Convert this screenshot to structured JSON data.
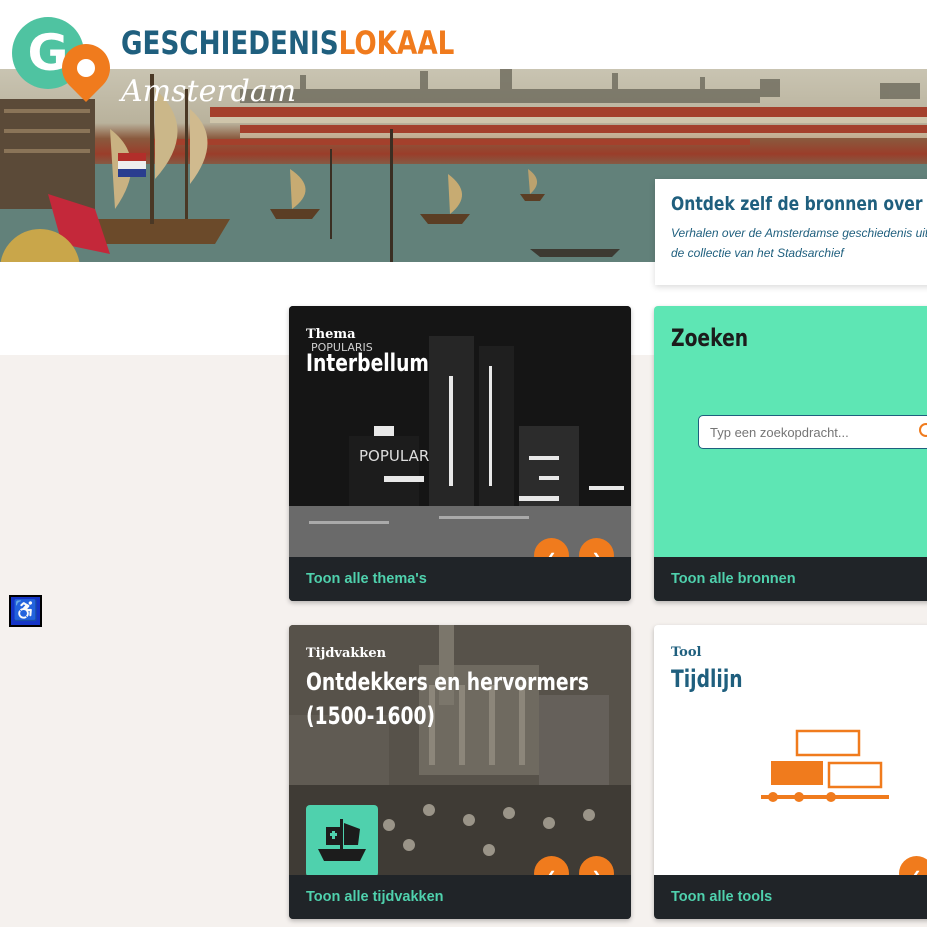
{
  "header": {
    "logo_letter": "G",
    "brand_part1": "GESCHIEDENIS",
    "brand_part2": "LOKAAL",
    "city": "Amsterdam"
  },
  "intro": {
    "title": "Ontdek zelf de bronnen over Ams",
    "subtitle": "Verhalen over de Amsterdamse geschiedenis uit de collectie van het Stadsarchief"
  },
  "cards": {
    "theme": {
      "label": "Thema",
      "title": "Interbellum",
      "footer": "Toon alle thema's",
      "prev": "‹",
      "next": "›"
    },
    "search": {
      "title": "Zoeken",
      "placeholder": "Typ een zoekopdracht...",
      "footer": "Toon alle bronnen"
    },
    "period": {
      "label": "Tijdvakken",
      "title_line1": "Ontdekkers en hervormers",
      "title_line2": "(1500-1600)",
      "footer": "Toon alle tijdvakken",
      "prev": "‹",
      "next": "›"
    },
    "tool": {
      "label": "Tool",
      "title": "Tijdlijn",
      "footer": "Toon alle tools",
      "prev": "‹"
    }
  },
  "accessibility": {
    "icon": "wheelchair-icon",
    "symbol": "♿"
  },
  "colors": {
    "teal": "#4fc3a1",
    "orange": "#f07b1d",
    "navy": "#1f5f7e",
    "mint": "#5ee6b4",
    "footer_dark": "#202428"
  }
}
